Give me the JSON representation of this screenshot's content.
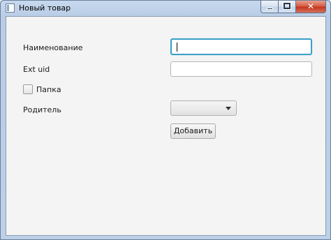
{
  "window": {
    "title": "Новый товар",
    "close_glyph": "✕"
  },
  "form": {
    "name_label": "Наименование",
    "name_value": "",
    "ext_uid_label": "Ext uid",
    "ext_uid_value": "",
    "folder_label": "Папка",
    "folder_checked": false,
    "parent_label": "Родитель",
    "parent_value": "",
    "add_button_label": "Добавить"
  },
  "icons": {
    "app": "window-app-icon",
    "minimize": "minimize-icon",
    "maximize": "maximize-icon",
    "close": "close-icon",
    "dropdown": "chevron-down-icon"
  },
  "colors": {
    "focus_border": "#3ca0c8",
    "close_button": "#c4331b"
  }
}
